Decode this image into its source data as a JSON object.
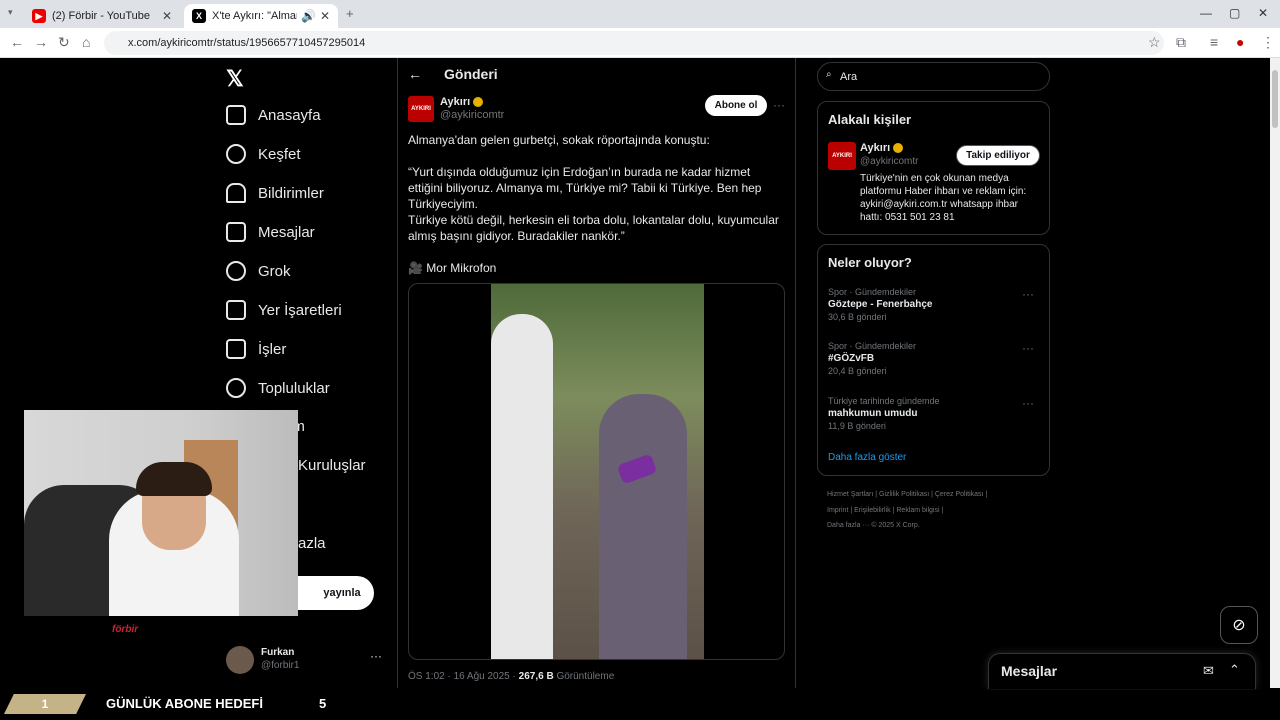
{
  "browser": {
    "tabs": [
      {
        "title": "(2) Förbir - YouTube",
        "icon": "youtube-icon"
      },
      {
        "title": "X'te Aykırı: \"Almanya'dan g",
        "icon": "x-icon"
      }
    ],
    "url": "x.com/aykiricomtr/status/1956657710457295014"
  },
  "sidebar": {
    "items": [
      {
        "label": "Anasayfa",
        "icon": "home-icon"
      },
      {
        "label": "Keşfet",
        "icon": "search-icon"
      },
      {
        "label": "Bildirimler",
        "icon": "bell-icon"
      },
      {
        "label": "Mesajlar",
        "icon": "mail-icon"
      },
      {
        "label": "Grok",
        "icon": "grok-icon"
      },
      {
        "label": "Yer İşaretleri",
        "icon": "bookmark-icon"
      },
      {
        "label": "İşler",
        "icon": "briefcase-icon"
      },
      {
        "label": "Topluluklar",
        "icon": "people-icon"
      },
      {
        "label": "um",
        "icon": "premium-icon"
      },
      {
        "label": "Kuruluşlar",
        "icon": "lightning-icon"
      },
      {
        "label": "azla",
        "icon": "more-icon"
      }
    ],
    "post_button": "yayınla",
    "user": {
      "name": "Furkan",
      "handle": "@forbir1"
    }
  },
  "header": {
    "title": "Gönderi"
  },
  "tweet": {
    "author": "Aykırı",
    "handle": "@aykiricomtr",
    "avatar_text": "AYKIRI",
    "subscribe": "Abone ol",
    "paragraphs": [
      "Almanya'dan gelen gurbetçi, sokak röportajında konuştu:",
      "“Yurt dışında olduğumuz için Erdoğan’ın burada ne kadar hizmet ettiğini biliyoruz. Almanya mı, Türkiye mi? Tabii ki Türkiye. Ben hep Türkiyeciyim.",
      "Türkiye kötü değil, herkesin eli torba dolu, lokantalar dolu, kuyumcular almış başını gidiyor. Buradakiler nankör.”",
      "🎥 Mor Mikrofon"
    ],
    "time": "ÖS 1:02 · 16 Ağu 2025 ·",
    "views": "267,6 B",
    "views_label": "Görüntüleme"
  },
  "search": {
    "placeholder": "Ara"
  },
  "related": {
    "title": "Alakalı kişiler",
    "name": "Aykırı",
    "handle": "@aykiricomtr",
    "follow": "Takip ediliyor",
    "bio": "Türkiye'nin en çok okunan medya platformu Haber ihbarı ve reklam için: aykiri@aykiri.com.tr whatsapp ihbar hattı: 0531 501 23 81"
  },
  "trends": {
    "title": "Neler oluyor?",
    "items": [
      {
        "context": "Spor · Gündemdekiler",
        "name": "Göztepe - Fenerbahçe",
        "count": "30,6 B gönderi"
      },
      {
        "context": "Spor · Gündemdekiler",
        "name": "#GÖZvFB",
        "count": "20,4 B gönderi"
      },
      {
        "context": "Türkiye tarihinde gündemde",
        "name": "mahkumun umudu",
        "count": "11,9 B gönderi"
      }
    ],
    "show_more": "Daha fazla göster"
  },
  "footer": {
    "line1": "Hizmet Şartları  |  Gizlilik Politikası  |  Çerez Politikası  |",
    "line2": "Imprint  |  Erişilebilirlik  |  Reklam bilgisi  |",
    "line3": "Daha fazla ···    © 2025 X Corp."
  },
  "dm": {
    "label": "Mesajlar"
  },
  "overlay": {
    "goal_count": "1",
    "goal_label": "GÜNLÜK ABONE HEDEFİ",
    "goal_target": "5",
    "cam_logo": "förbir"
  }
}
